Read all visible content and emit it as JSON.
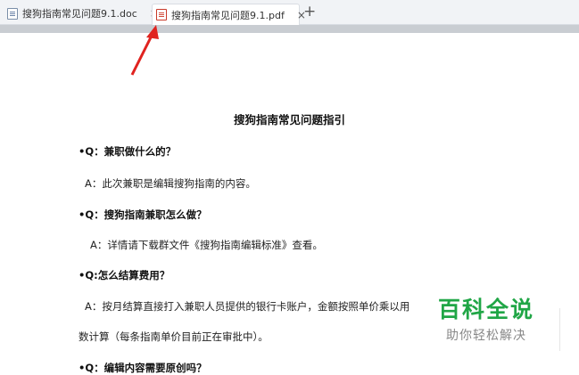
{
  "tabs": [
    {
      "label": "搜狗指南常见问题9.1.doc",
      "close": "×"
    },
    {
      "label": "搜狗指南常见问题9.1.pdf",
      "close": "×"
    }
  ],
  "new_tab": "+",
  "document": {
    "title": "搜狗指南常见问题指引",
    "lines": [
      "•Q：兼职做什么的？",
      "A：此次兼职是编辑搜狗指南的内容。",
      "•Q：搜狗指南兼职怎么做？",
      "A：详情请下载群文件《搜狗指南编辑标准》查看。",
      "•Q:怎么结算费用？",
      "A：按月结算直接打入兼职人员提供的银行卡账户，金额按照单价乘以用",
      "数计算（每条指南单价目前正在审批中）。",
      "•Q：编辑内容需要原创吗？"
    ]
  },
  "watermark": {
    "main": "百科全说",
    "sub": "助你轻松解决"
  },
  "colors": {
    "watermark_green": "#20a646",
    "arrow_red": "#e0231f"
  }
}
